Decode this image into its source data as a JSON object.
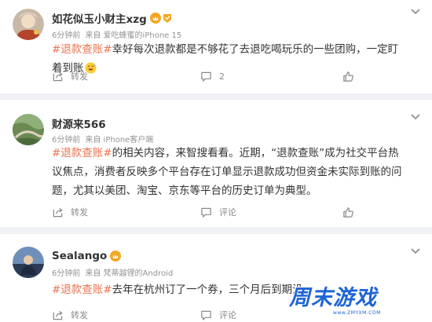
{
  "posts": [
    {
      "author": "如花似玉小财主xzg",
      "meta_time": "6分钟前",
      "meta_source": "来自 爱吃蜂蜜的iPhone 15",
      "hashtag": "#退款查账#",
      "text": "幸好每次退款都是不够花了去退吃喝玩乐的一些团购，一定盯着到账",
      "emoji": "grinning-sweat-emoji",
      "share_label": "转发",
      "comment_label": "2",
      "like_label": "",
      "has_badge": true
    },
    {
      "author": "财源来566",
      "meta_time": "6分钟前",
      "meta_source": "来自 iPhone客户端",
      "hashtag": "#退款查账#",
      "text": "的相关内容，来智搜看看。近期，“退款查账”成为社交平台热议焦点，消费者反映多个平台存在订单显示退款成功但资金未实际到账的问题，尤其以美团、淘宝、京东等平台的历史订单为典型。",
      "share_label": "转发",
      "comment_label": "评论",
      "like_label": "",
      "has_badge": false
    },
    {
      "author": "Sealango",
      "meta_time": "6分钟前",
      "meta_source": "来自 梵蒂越锂的Android",
      "hashtag": "#退款查账#",
      "text": "去年在杭州订了一个券，三个月后到期没",
      "share_label": "转发",
      "comment_label": "评论",
      "like_label": "",
      "has_badge": true
    }
  ],
  "watermark": {
    "text": "周末游戏",
    "url_text": "www.ZMYXM.COM"
  },
  "colors": {
    "hashtag": "#eb7350",
    "muted": "#939393",
    "page_bg": "#f0f1f4",
    "badge": "#f5a623",
    "watermark_blue": "#1e64d6"
  },
  "icons": [
    "chevron-down-icon",
    "share-icon",
    "comment-icon",
    "like-icon",
    "vip-badge-icon",
    "grinning-sweat-emoji"
  ]
}
